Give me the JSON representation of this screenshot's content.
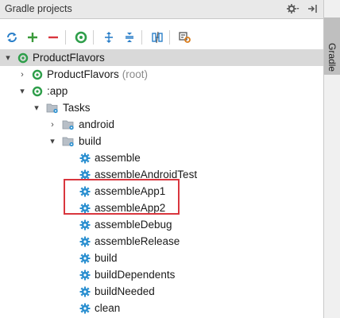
{
  "panel": {
    "title": "Gradle projects"
  },
  "side_tab": {
    "label": "Gradle"
  },
  "tree": {
    "root": "ProductFlavors",
    "root_project": "ProductFlavors",
    "root_project_suffix": "(root)",
    "module": ":app",
    "tasks_folder": "Tasks",
    "android_folder": "android",
    "build_folder": "build",
    "tasks": [
      "assemble",
      "assembleAndroidTest",
      "assembleApp1",
      "assembleApp2",
      "assembleDebug",
      "assembleRelease",
      "build",
      "buildDependents",
      "buildNeeded",
      "clean"
    ]
  },
  "colors": {
    "highlight_border": "#d9363e",
    "gradle_green": "#2e9e4a",
    "gear_blue": "#2a8fd0",
    "selection": "#d9d9d9"
  }
}
